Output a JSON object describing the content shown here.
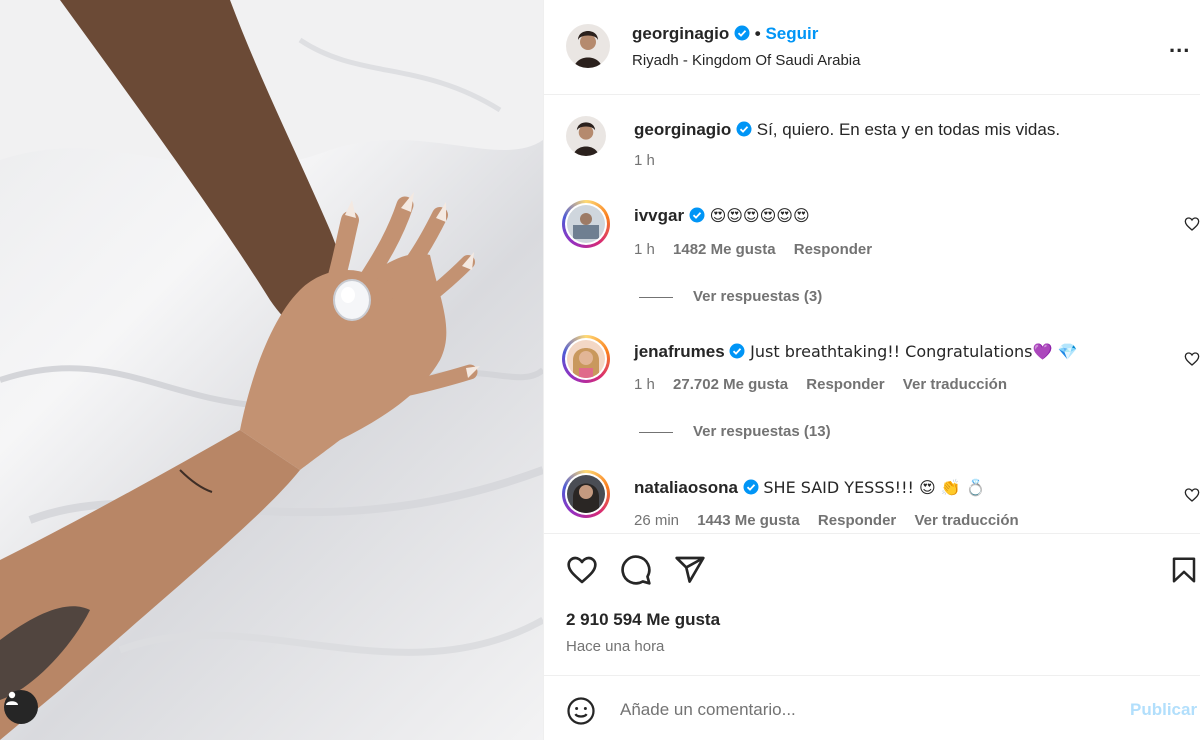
{
  "post": {
    "username": "georginagio",
    "separator": "•",
    "follow_label": "Seguir",
    "location": "Riyadh - Kingdom Of Saudi Arabia",
    "more_label": "..."
  },
  "caption": {
    "username": "georginagio",
    "text": "Sí, quiero. En esta y en todas mis vidas.",
    "time": "1 h"
  },
  "comments": [
    {
      "username": "ivvgar",
      "text": "😍😍😍😍😍😍",
      "time": "1 h",
      "likes": "1482 Me gusta",
      "reply": "Responder",
      "translate": "",
      "view_replies": "Ver respuestas (3)"
    },
    {
      "username": "jenafrumes",
      "text": "Just breathtaking!! Congratulations💜 💎",
      "time": "1 h",
      "likes": "27.702 Me gusta",
      "reply": "Responder",
      "translate": "Ver traducción",
      "view_replies": "Ver respuestas (13)"
    },
    {
      "username": "nataliaosona",
      "text": "SHE SAID YESSS!!! 😍 👏 💍",
      "time": "26 min",
      "likes": "1443 Me gusta",
      "reply": "Responder",
      "translate": "Ver traducción",
      "view_replies": ""
    }
  ],
  "actions": {
    "likes": "2 910 594 Me gusta",
    "time": "Hace una hora"
  },
  "add_comment": {
    "placeholder": "Añade un comentario...",
    "publish": "Publicar"
  },
  "colors": {
    "link_blue": "#0095f6",
    "publish_disabled": "#b2dffc",
    "verified": "#0095f6",
    "muted": "#737373"
  },
  "icons": [
    "verified-badge-icon",
    "more-options-icon",
    "heart-icon",
    "comment-icon",
    "share-icon",
    "bookmark-icon",
    "emoji-icon",
    "user-tag-icon"
  ]
}
